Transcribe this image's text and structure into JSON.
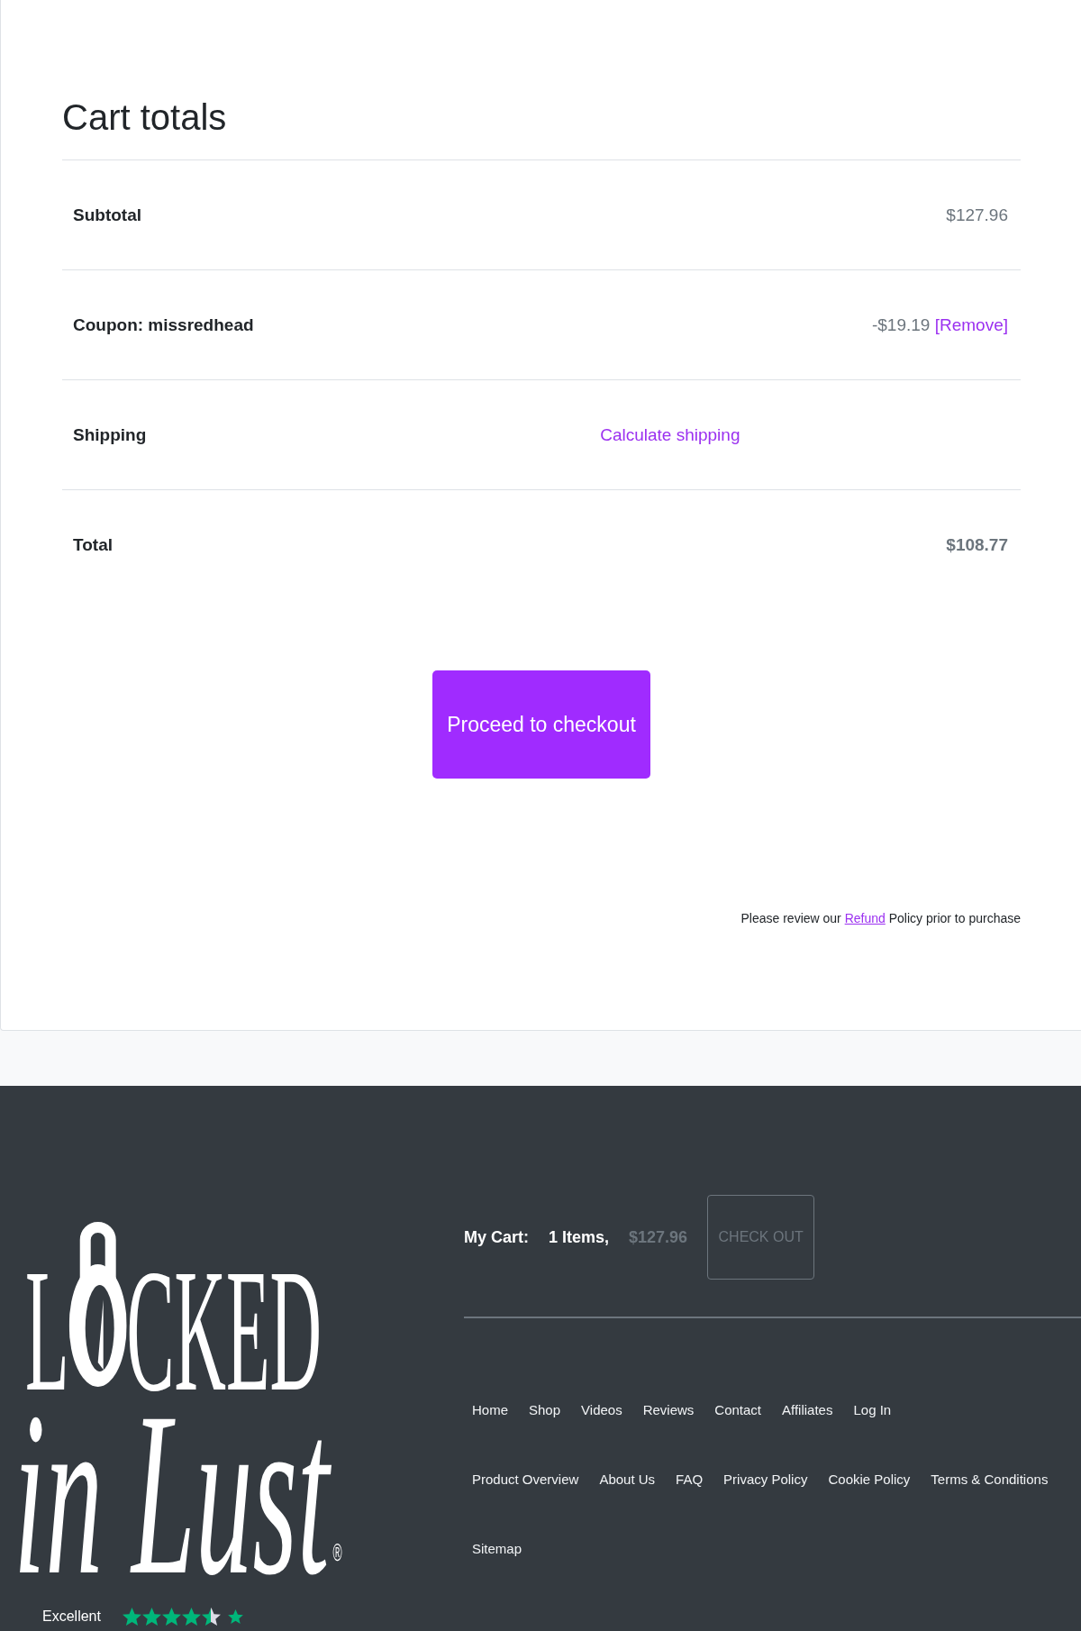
{
  "cart_totals": {
    "title": "Cart totals",
    "rows": [
      {
        "kind": "amount",
        "label": "Subtotal",
        "value": "$127.96"
      },
      {
        "kind": "coupon",
        "label": "Coupon: missredhead",
        "value": "-$19.19",
        "action": "[Remove]"
      },
      {
        "kind": "link",
        "label": "Shipping",
        "link": "Calculate shipping"
      },
      {
        "kind": "total",
        "label": "Total",
        "value": "$108.77"
      }
    ],
    "checkout_button": "Proceed to checkout",
    "refund_note": {
      "before": "Please review our",
      "link": "Refund",
      "after": "Policy prior to purchase"
    }
  },
  "footer": {
    "logo": {
      "initial": "L",
      "rest": "CKED",
      "script": "in Lust",
      "registered": "®"
    },
    "mini_cart": {
      "label": "My Cart:",
      "count": "1 Items,",
      "amount": "$127.96",
      "button": "CHECK OUT"
    },
    "main_menu": [
      "Home",
      "Shop",
      "Videos",
      "Reviews",
      "Contact",
      "Affiliates",
      "Log In"
    ],
    "footer_menu": [
      "Product Overview",
      "About Us",
      "FAQ",
      "Privacy Policy",
      "Cookie Policy",
      "Terms & Conditions",
      "Sitemap"
    ],
    "trustpilot": {
      "rating": "Excellent",
      "stars": 4.5
    }
  }
}
